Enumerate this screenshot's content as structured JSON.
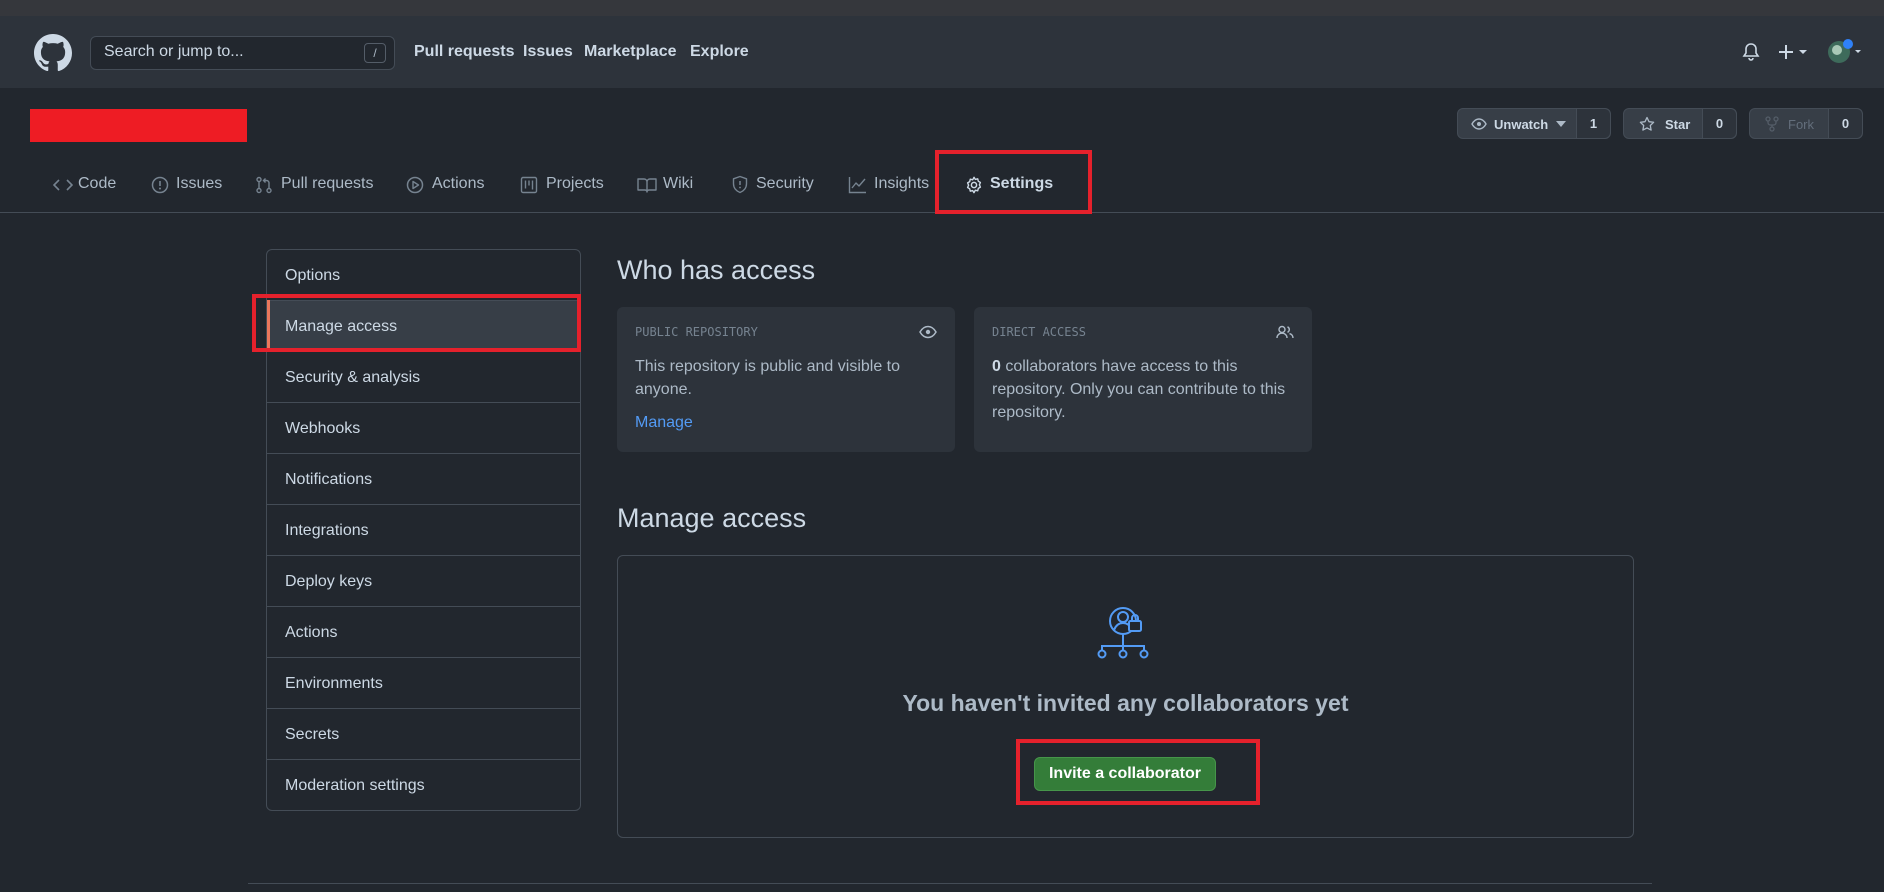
{
  "header": {
    "search_placeholder": "Search or jump to...",
    "search_shortcut": "/",
    "nav": [
      "Pull requests",
      "Issues",
      "Marketplace",
      "Explore"
    ]
  },
  "repo_buttons": {
    "watch_label": "Unwatch",
    "watch_count": "1",
    "star_label": "Star",
    "star_count": "0",
    "fork_label": "Fork",
    "fork_count": "0"
  },
  "tabs": [
    {
      "label": "Code",
      "icon": "code-icon"
    },
    {
      "label": "Issues",
      "icon": "issue-icon"
    },
    {
      "label": "Pull requests",
      "icon": "pull-request-icon"
    },
    {
      "label": "Actions",
      "icon": "play-icon"
    },
    {
      "label": "Projects",
      "icon": "project-icon"
    },
    {
      "label": "Wiki",
      "icon": "book-icon"
    },
    {
      "label": "Security",
      "icon": "shield-icon"
    },
    {
      "label": "Insights",
      "icon": "graph-icon"
    },
    {
      "label": "Settings",
      "icon": "gear-icon"
    }
  ],
  "sidebar": {
    "items": [
      "Options",
      "Manage access",
      "Security & analysis",
      "Webhooks",
      "Notifications",
      "Integrations",
      "Deploy keys",
      "Actions",
      "Environments",
      "Secrets",
      "Moderation settings"
    ],
    "active": "Manage access"
  },
  "main": {
    "who_has_access_title": "Who has access",
    "public_card": {
      "label": "PUBLIC REPOSITORY",
      "text": "This repository is public and visible to anyone.",
      "link": "Manage"
    },
    "direct_card": {
      "label": "DIRECT ACCESS",
      "count": "0",
      "text": " collaborators have access to this repository. Only you can contribute to this repository."
    },
    "manage_access_title": "Manage access",
    "empty_title": "You haven't invited any collaborators yet",
    "invite_button": "Invite a collaborator"
  },
  "colors": {
    "accent_underline": "#ec775c",
    "link": "#539bf5",
    "primary_button": "#347d39",
    "highlight_box": "#e5212c"
  }
}
